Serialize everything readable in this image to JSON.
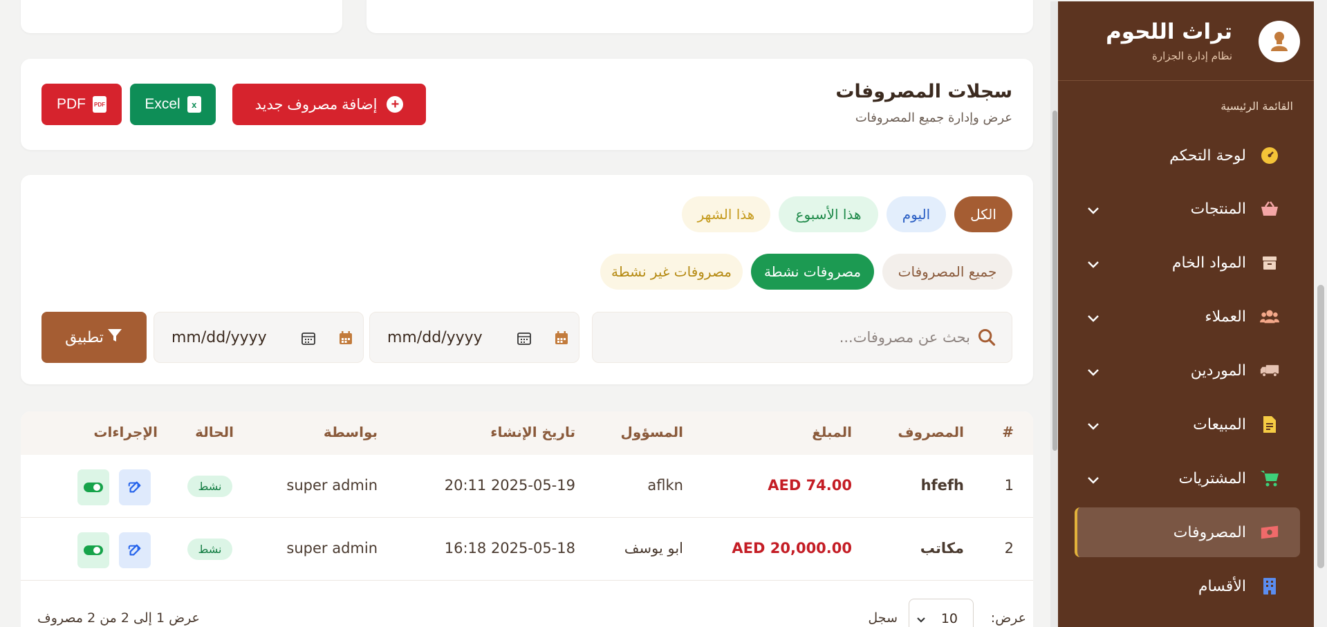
{
  "brand": {
    "title": "تراث اللحوم",
    "subtitle": "نظام إدارة الجزارة"
  },
  "sidebar": {
    "section": "القائمة الرئيسية",
    "items": [
      {
        "label": "لوحة التحكم",
        "icon": "gauge-icon"
      },
      {
        "label": "المنتجات",
        "icon": "basket-icon"
      },
      {
        "label": "المواد الخام",
        "icon": "box-icon"
      },
      {
        "label": "العملاء",
        "icon": "users-icon"
      },
      {
        "label": "الموردين",
        "icon": "truck-icon"
      },
      {
        "label": "المبيعات",
        "icon": "invoice-icon"
      },
      {
        "label": "المشتريات",
        "icon": "cart-icon"
      },
      {
        "label": "المصروفات",
        "icon": "money-icon"
      },
      {
        "label": "الأقسام",
        "icon": "building-icon"
      }
    ]
  },
  "header": {
    "title": "سجلات المصروفات",
    "subtitle": "عرض وإدارة جميع المصروفات",
    "add_label": "إضافة مصروف جديد",
    "excel_label": "Excel",
    "pdf_label": "PDF"
  },
  "filters": {
    "period": [
      "الكل",
      "اليوم",
      "هذا الأسبوع",
      "هذا الشهر"
    ],
    "status": [
      "جميع المصروفات",
      "مصروفات نشطة",
      "مصروفات غير نشطة"
    ],
    "search_placeholder": "بحث عن مصروفات...",
    "date_from": "mm/dd/yyyy",
    "date_to": "mm/dd/yyyy",
    "apply_label": "تطبيق"
  },
  "table": {
    "headers": [
      "#",
      "المصروف",
      "المبلغ",
      "المسؤول",
      "تاريخ الإنشاء",
      "بواسطة",
      "الحالة",
      "الإجراءات"
    ],
    "rows": [
      {
        "num": "1",
        "name": "hfefh",
        "amount": "AED 74.00",
        "owner": "aflkn",
        "date": "20:11 2025-05-19",
        "by": "super admin",
        "status": "نشط"
      },
      {
        "num": "2",
        "name": "مكاتب",
        "amount": "AED 20,000.00",
        "owner": "ابو يوسف",
        "date": "16:18 2025-05-18",
        "by": "super admin",
        "status": "نشط"
      }
    ]
  },
  "footer": {
    "show_label": "عرض:",
    "per_page": "10",
    "records_label": "سجل",
    "summary": "عرض 1 إلى 2 من 2 مصروف"
  },
  "colors": {
    "sidebar": "#5c3420",
    "accent": "#a55d33",
    "red": "#d6232d",
    "green": "#0e8e57"
  }
}
